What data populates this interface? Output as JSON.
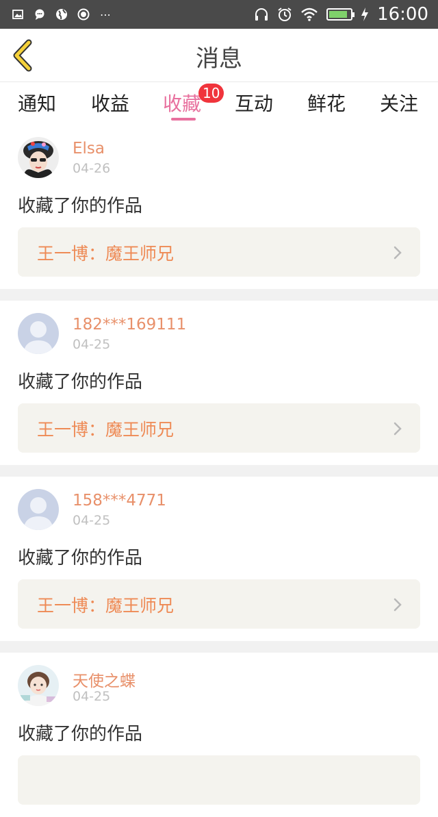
{
  "status_bar": {
    "time": "16:00",
    "battery_level": 0.85
  },
  "header": {
    "title": "消息"
  },
  "tabs": [
    {
      "label": "通知"
    },
    {
      "label": "收益"
    },
    {
      "label": "收藏",
      "active": true,
      "badge": "10"
    },
    {
      "label": "互动"
    },
    {
      "label": "鲜花"
    },
    {
      "label": "关注"
    }
  ],
  "colors": {
    "accent_pink": "#e8709e",
    "username_orange": "#e8906a",
    "work_title_orange": "#ee8a55",
    "badge_red": "#f0343c"
  },
  "messages": [
    {
      "username": "Elsa",
      "date": "04-26",
      "action": "收藏了你的作品",
      "work": "王一博：魔王师兄",
      "avatar_icon": "user-photo-icon"
    },
    {
      "username": "182***169111",
      "date": "04-25",
      "action": "收藏了你的作品",
      "work": "王一博：魔王师兄",
      "avatar_icon": "default-avatar-icon"
    },
    {
      "username": "158***4771",
      "date": "04-25",
      "action": "收藏了你的作品",
      "work": "王一博：魔王师兄",
      "avatar_icon": "default-avatar-icon"
    },
    {
      "username": "天使之蝶",
      "date": "04-25",
      "action": "收藏了你的作品",
      "avatar_icon": "user-photo-icon"
    }
  ]
}
